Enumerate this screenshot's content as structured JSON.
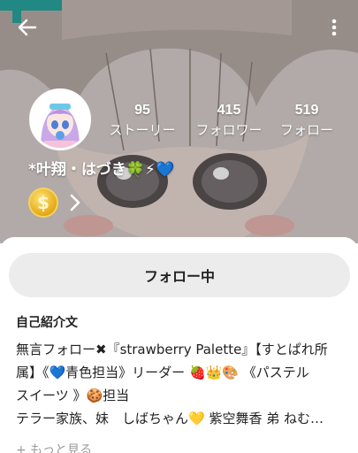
{
  "header": {
    "back_icon": "arrow-left-icon",
    "more_icon": "more-vertical-icon"
  },
  "profile": {
    "username": "*叶翔・はづき🍀⚡💙",
    "coin_symbol": "$"
  },
  "stats": [
    {
      "value": "95",
      "label": "ストーリー"
    },
    {
      "value": "415",
      "label": "フォロワー"
    },
    {
      "value": "519",
      "label": "フォロー"
    }
  ],
  "follow_button": {
    "label": "フォロー中"
  },
  "bio": {
    "heading": "自己紹介文",
    "lines": [
      "無言フォロー✖『strawberry Palette』【すとぱれ所",
      "属】《💙青色担当》リーダー 🍓👑🎨 《パステル",
      "スイーツ 》🍪担当",
      "テラー家族、妹　しばちゃん💛 紫空舞香 弟 ねむ…"
    ],
    "more_link": "+ もっと見る"
  },
  "colors": {
    "background": "#ffffff",
    "button_bg": "#ececec",
    "muted_text": "#9a9a9a",
    "coin_gold": "#e3a916"
  }
}
